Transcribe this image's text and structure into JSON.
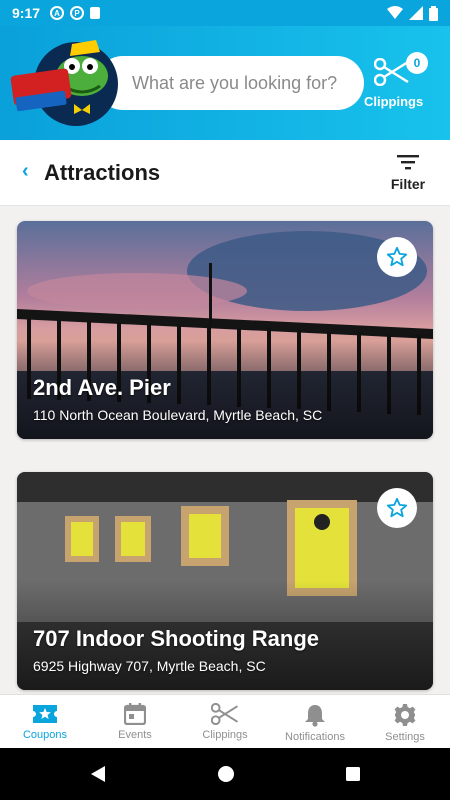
{
  "status_bar": {
    "time": "9:17"
  },
  "header": {
    "search_placeholder": "What are you looking for?",
    "clippings_count": "0",
    "clippings_label": "Clippings"
  },
  "title_row": {
    "title": "Attractions",
    "filter_label": "Filter"
  },
  "attractions": [
    {
      "name": "2nd Ave. Pier",
      "address": "110 North Ocean Boulevard, Myrtle Beach, SC"
    },
    {
      "name": "707 Indoor Shooting Range",
      "address": "6925 Highway 707, Myrtle Beach, SC"
    }
  ],
  "bottom_nav": [
    {
      "label": "Coupons",
      "icon": "coupon-star-icon",
      "active": true
    },
    {
      "label": "Events",
      "icon": "calendar-icon",
      "active": false
    },
    {
      "label": "Clippings",
      "icon": "scissors-icon",
      "active": false
    },
    {
      "label": "Notifications",
      "icon": "bell-icon",
      "active": false
    },
    {
      "label": "Settings",
      "icon": "gear-icon",
      "active": false
    }
  ],
  "colors": {
    "accent": "#0aa5dc",
    "header_gradient_start": "#0aa0da",
    "header_gradient_end": "#18c2ec"
  }
}
